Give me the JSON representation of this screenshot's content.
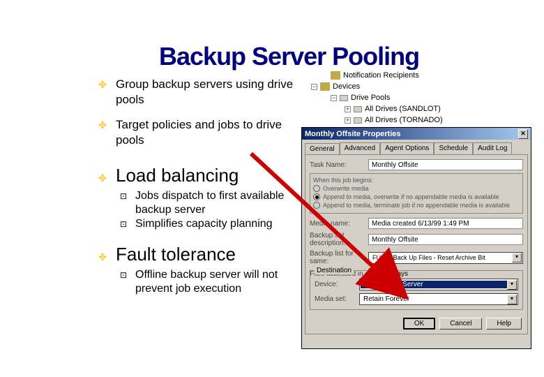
{
  "title_parts": {
    "pre": "Backu",
    "p1": "p",
    "mid": " Server Poolin",
    "g": "g"
  },
  "title": "Backup Server Pooling",
  "bullets": {
    "b1a": "Group backup servers using drive pools",
    "b1b": "Target policies and jobs to drive pools",
    "h2a": "Load balancing",
    "b2a1": "Jobs dispatch to first available backup server",
    "b2a2": "Simplifies capacity planning",
    "h2b": "Fault tolerance",
    "b2b1": "Offline backup server will not prevent job execution"
  },
  "tree": {
    "n0": "Notification Recipients",
    "n1": "Devices",
    "n2": "Drive Pools",
    "n3": "All Drives (SANDLOT)",
    "n4": "All Drives (TORNADO)"
  },
  "dialog": {
    "title": "Monthly Offsite Properties",
    "tabs": [
      "General",
      "Advanced",
      "Agent Options",
      "Schedule",
      "Audit Log"
    ],
    "task_label": "Task Name:",
    "task_value": "Monthly Offsite",
    "radio_caption": "When this job begins:",
    "r1": "Overwrite media",
    "r2": "Append to media, overwrite if no appendable media is available",
    "r3": "Append to media, terminate job if no appendable media is available",
    "media_name_label": "Media name:",
    "media_name_value": "Media created 6/13/99 1:49 PM",
    "backup_set_label": "Backup set description:",
    "backup_set_value": "Monthly Offsite",
    "backup_list_label": "Backup list for same:",
    "backup_list_value": "FULL - Back Up Files - Reset Archive Bit",
    "files_label": "Files accessed in",
    "files_days": "30",
    "files_days_unit": "days",
    "dest_legend": "Destination",
    "device_label": "Device:",
    "device_value": "Any Backup Server",
    "mediaset_label": "Media set:",
    "mediaset_value": "Retain Forever",
    "ok": "OK",
    "cancel": "Cancel",
    "help": "Help"
  }
}
